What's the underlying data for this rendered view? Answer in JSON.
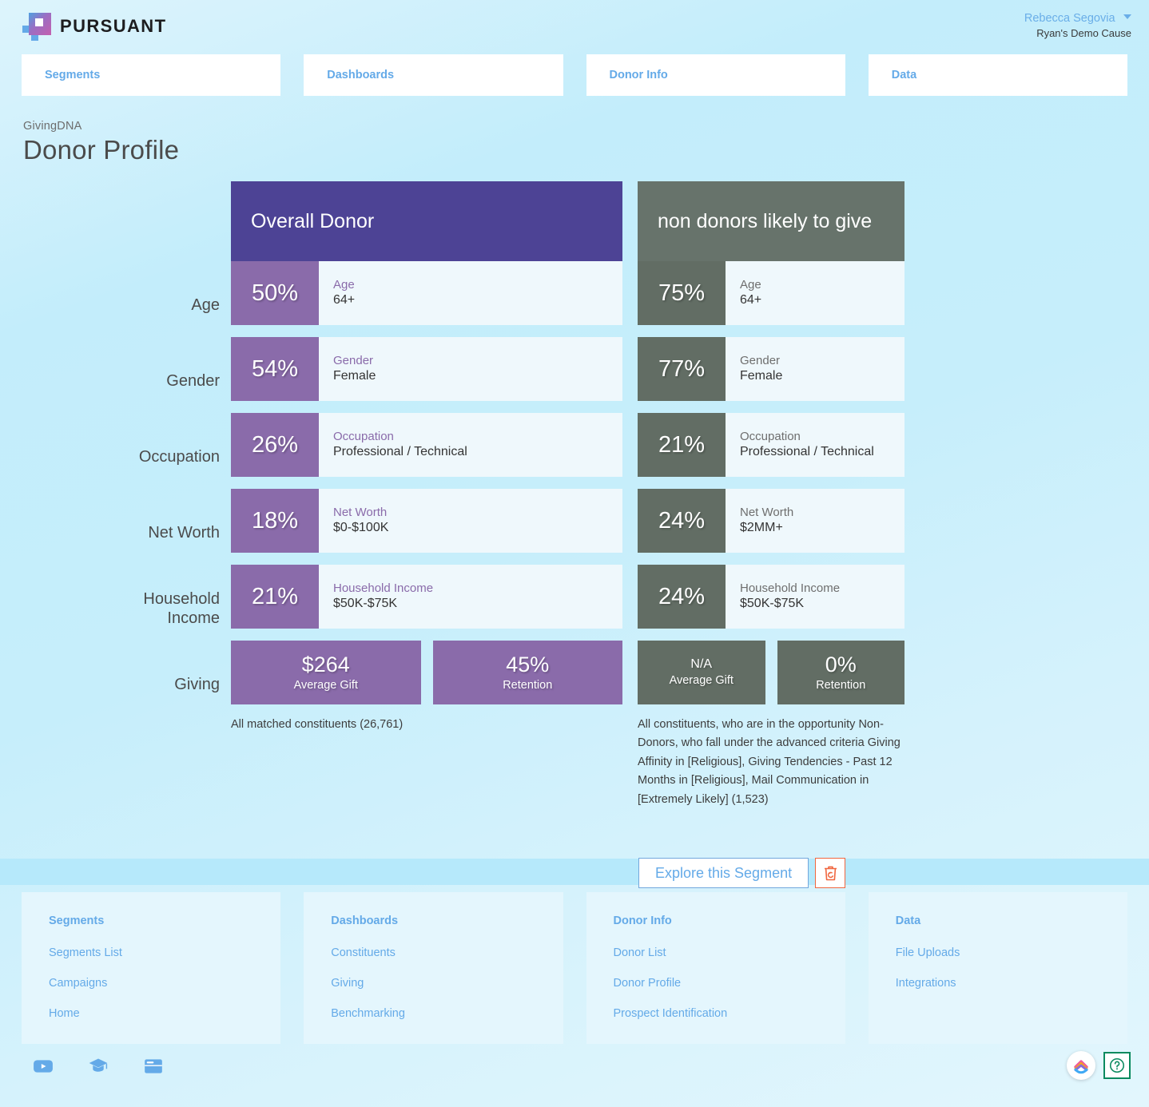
{
  "header": {
    "brand_name": "PURSUANT",
    "user_name": "Rebecca Segovia",
    "user_org": "Ryan's Demo Cause"
  },
  "nav_tabs": [
    {
      "label": "Segments"
    },
    {
      "label": "Dashboards"
    },
    {
      "label": "Donor Info"
    },
    {
      "label": "Data"
    }
  ],
  "page": {
    "eyebrow": "GivingDNA",
    "title": "Donor Profile"
  },
  "colors": {
    "primary_header": "#4d4395",
    "primary_tile": "#8a6baa",
    "compare_header": "#67736b",
    "compare_tile": "#626d64",
    "link_blue": "#64aae8",
    "accent_bar": "#b6e9fb",
    "delete_red": "#f0663f",
    "help_green": "#0a8a5f"
  },
  "profile": {
    "row_labels": [
      {
        "lines": [
          "Age"
        ]
      },
      {
        "lines": [
          "Gender"
        ]
      },
      {
        "lines": [
          "Occupation"
        ]
      },
      {
        "lines": [
          "Net Worth"
        ]
      },
      {
        "lines": [
          "Household",
          "Income"
        ]
      },
      {
        "lines": [
          "Giving"
        ]
      }
    ],
    "columns": [
      {
        "title": "Overall Donor",
        "theme": "purple",
        "stats": [
          {
            "pct": "50%",
            "label": "Age",
            "value": "64+"
          },
          {
            "pct": "54%",
            "label": "Gender",
            "value": "Female"
          },
          {
            "pct": "26%",
            "label": "Occupation",
            "value": "Professional / Technical"
          },
          {
            "pct": "18%",
            "label": "Net Worth",
            "value": "$0-$100K"
          },
          {
            "pct": "21%",
            "label": "Household Income",
            "value": "$50K-$75K"
          }
        ],
        "giving": [
          {
            "big": "$264",
            "sub": "Average Gift",
            "small": false
          },
          {
            "big": "45%",
            "sub": "Retention",
            "small": false
          }
        ],
        "footnote": "All matched constituents (26,761)"
      },
      {
        "title": "non donors likely to give",
        "theme": "olive",
        "stats": [
          {
            "pct": "75%",
            "label": "Age",
            "value": "64+"
          },
          {
            "pct": "77%",
            "label": "Gender",
            "value": "Female"
          },
          {
            "pct": "21%",
            "label": "Occupation",
            "value": "Professional / Technical"
          },
          {
            "pct": "24%",
            "label": "Net Worth",
            "value": "$2MM+"
          },
          {
            "pct": "24%",
            "label": "Household Income",
            "value": "$50K-$75K"
          }
        ],
        "giving": [
          {
            "big": "N/A",
            "sub": "Average Gift",
            "small": true
          },
          {
            "big": "0%",
            "sub": "Retention",
            "small": false
          }
        ],
        "footnote": "All constituents, who are in the opportunity Non-Donors, who fall under the advanced criteria Giving Affinity in [Religious], Giving Tendencies - Past 12 Months in [Religious], Mail Communication in [Extremely Likely] (1,523)"
      }
    ]
  },
  "actions": {
    "explore_label": "Explore this Segment",
    "delete_icon": "trash-restore-icon"
  },
  "footer": {
    "columns": [
      {
        "heading": "Segments",
        "links": [
          "Segments List",
          "Campaigns",
          "Home"
        ]
      },
      {
        "heading": "Dashboards",
        "links": [
          "Constituents",
          "Giving",
          "Benchmarking"
        ]
      },
      {
        "heading": "Donor Info",
        "links": [
          "Donor List",
          "Donor Profile",
          "Prospect Identification"
        ]
      },
      {
        "heading": "Data",
        "links": [
          "File Uploads",
          "Integrations"
        ]
      }
    ],
    "social_icons": [
      "youtube-icon",
      "graduation-cap-icon",
      "browser-window-icon"
    ],
    "help_icons": [
      "chevron-up-circle-icon",
      "question-mark-icon"
    ]
  }
}
